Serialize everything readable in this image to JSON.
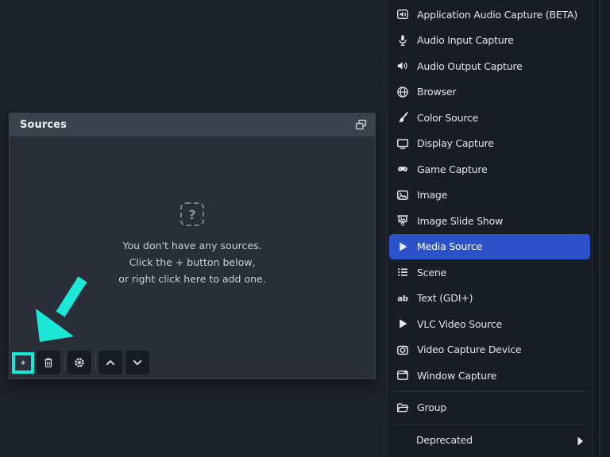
{
  "colors": {
    "accent_cyan": "#1be8d6",
    "highlight_blue": "#2b52c9",
    "panel_header_bg": "#3b414d",
    "panel_body_bg": "#2a2e39",
    "menu_bg": "#181c26",
    "page_bg": "#1e222b"
  },
  "sources_panel": {
    "title": "Sources",
    "popout_icon": "popout-icon",
    "empty_state": {
      "icon_glyph": "?",
      "line1": "You don't have any sources.",
      "line2": "Click the + button below,",
      "line3": "or right click here to add one."
    },
    "toolbar": [
      {
        "type": "button",
        "name": "add-source-button",
        "icon": "plus-icon",
        "highlighted": true
      },
      {
        "type": "button",
        "name": "remove-source-button",
        "icon": "trash-icon"
      },
      {
        "type": "separator"
      },
      {
        "type": "button",
        "name": "source-properties-button",
        "icon": "gear-icon"
      },
      {
        "type": "separator"
      },
      {
        "type": "button",
        "name": "move-source-up-button",
        "icon": "chevron-up-icon"
      },
      {
        "type": "button",
        "name": "move-source-down-button",
        "icon": "chevron-down-icon"
      }
    ]
  },
  "add_source_menu": {
    "items": [
      {
        "type": "item",
        "label": "Application Audio Capture (BETA)",
        "icon": "application-audio-capture-icon"
      },
      {
        "type": "item",
        "label": "Audio Input Capture",
        "icon": "audio-input-capture-icon"
      },
      {
        "type": "item",
        "label": "Audio Output Capture",
        "icon": "audio-output-capture-icon"
      },
      {
        "type": "item",
        "label": "Browser",
        "icon": "browser-icon"
      },
      {
        "type": "item",
        "label": "Color Source",
        "icon": "color-source-icon"
      },
      {
        "type": "item",
        "label": "Display Capture",
        "icon": "display-capture-icon"
      },
      {
        "type": "item",
        "label": "Game Capture",
        "icon": "game-capture-icon"
      },
      {
        "type": "item",
        "label": "Image",
        "icon": "image-icon"
      },
      {
        "type": "item",
        "label": "Image Slide Show",
        "icon": "image-slide-show-icon"
      },
      {
        "type": "item",
        "label": "Media Source",
        "icon": "media-source-icon",
        "selected": true
      },
      {
        "type": "item",
        "label": "Scene",
        "icon": "scene-icon"
      },
      {
        "type": "item",
        "label": "Text (GDI+)",
        "icon": "text-gdi-icon"
      },
      {
        "type": "item",
        "label": "VLC Video Source",
        "icon": "vlc-video-source-icon"
      },
      {
        "type": "item",
        "label": "Video Capture Device",
        "icon": "video-capture-device-icon"
      },
      {
        "type": "item",
        "label": "Window Capture",
        "icon": "window-capture-icon"
      },
      {
        "type": "separator"
      },
      {
        "type": "item",
        "label": "Group",
        "icon": "group-icon"
      },
      {
        "type": "separator"
      },
      {
        "type": "item",
        "label": "Deprecated",
        "icon": null,
        "submenu": true
      }
    ]
  }
}
